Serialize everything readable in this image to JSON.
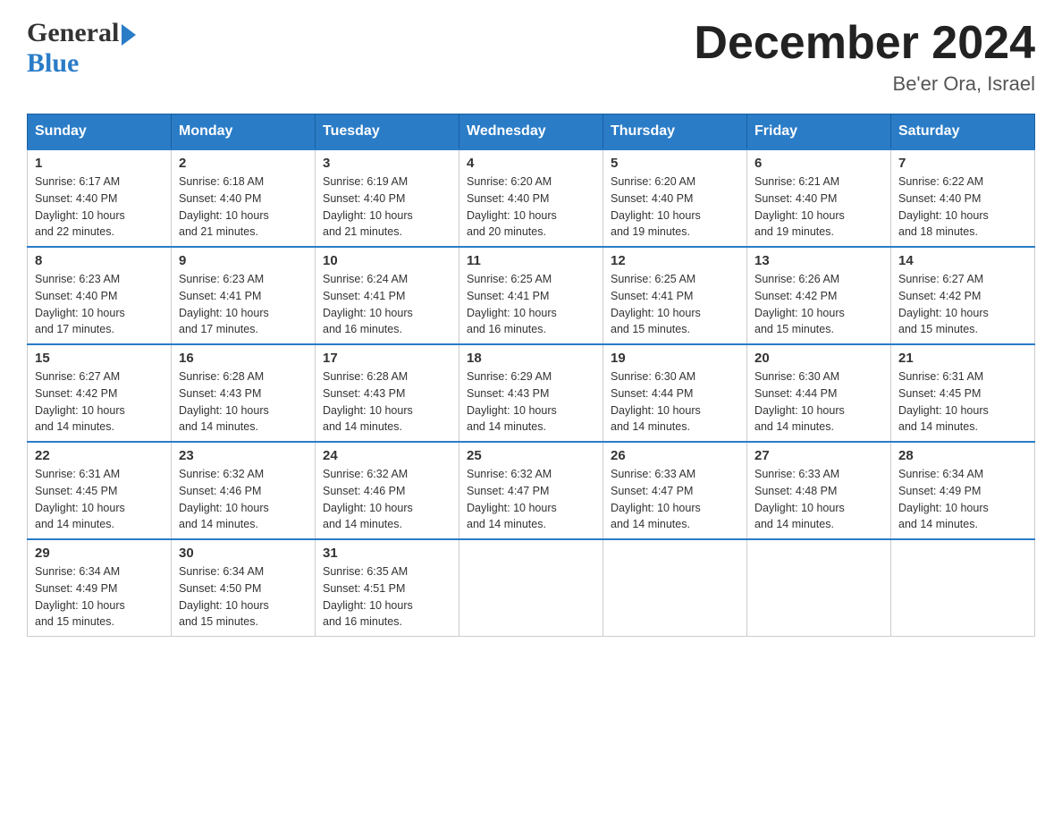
{
  "header": {
    "logo_line1": "General",
    "logo_line2": "Blue",
    "month": "December 2024",
    "location": "Be'er Ora, Israel"
  },
  "days_of_week": [
    "Sunday",
    "Monday",
    "Tuesday",
    "Wednesday",
    "Thursday",
    "Friday",
    "Saturday"
  ],
  "weeks": [
    [
      {
        "day": "1",
        "sunrise": "6:17 AM",
        "sunset": "4:40 PM",
        "daylight": "10 hours and 22 minutes."
      },
      {
        "day": "2",
        "sunrise": "6:18 AM",
        "sunset": "4:40 PM",
        "daylight": "10 hours and 21 minutes."
      },
      {
        "day": "3",
        "sunrise": "6:19 AM",
        "sunset": "4:40 PM",
        "daylight": "10 hours and 21 minutes."
      },
      {
        "day": "4",
        "sunrise": "6:20 AM",
        "sunset": "4:40 PM",
        "daylight": "10 hours and 20 minutes."
      },
      {
        "day": "5",
        "sunrise": "6:20 AM",
        "sunset": "4:40 PM",
        "daylight": "10 hours and 19 minutes."
      },
      {
        "day": "6",
        "sunrise": "6:21 AM",
        "sunset": "4:40 PM",
        "daylight": "10 hours and 19 minutes."
      },
      {
        "day": "7",
        "sunrise": "6:22 AM",
        "sunset": "4:40 PM",
        "daylight": "10 hours and 18 minutes."
      }
    ],
    [
      {
        "day": "8",
        "sunrise": "6:23 AM",
        "sunset": "4:40 PM",
        "daylight": "10 hours and 17 minutes."
      },
      {
        "day": "9",
        "sunrise": "6:23 AM",
        "sunset": "4:41 PM",
        "daylight": "10 hours and 17 minutes."
      },
      {
        "day": "10",
        "sunrise": "6:24 AM",
        "sunset": "4:41 PM",
        "daylight": "10 hours and 16 minutes."
      },
      {
        "day": "11",
        "sunrise": "6:25 AM",
        "sunset": "4:41 PM",
        "daylight": "10 hours and 16 minutes."
      },
      {
        "day": "12",
        "sunrise": "6:25 AM",
        "sunset": "4:41 PM",
        "daylight": "10 hours and 15 minutes."
      },
      {
        "day": "13",
        "sunrise": "6:26 AM",
        "sunset": "4:42 PM",
        "daylight": "10 hours and 15 minutes."
      },
      {
        "day": "14",
        "sunrise": "6:27 AM",
        "sunset": "4:42 PM",
        "daylight": "10 hours and 15 minutes."
      }
    ],
    [
      {
        "day": "15",
        "sunrise": "6:27 AM",
        "sunset": "4:42 PM",
        "daylight": "10 hours and 14 minutes."
      },
      {
        "day": "16",
        "sunrise": "6:28 AM",
        "sunset": "4:43 PM",
        "daylight": "10 hours and 14 minutes."
      },
      {
        "day": "17",
        "sunrise": "6:28 AM",
        "sunset": "4:43 PM",
        "daylight": "10 hours and 14 minutes."
      },
      {
        "day": "18",
        "sunrise": "6:29 AM",
        "sunset": "4:43 PM",
        "daylight": "10 hours and 14 minutes."
      },
      {
        "day": "19",
        "sunrise": "6:30 AM",
        "sunset": "4:44 PM",
        "daylight": "10 hours and 14 minutes."
      },
      {
        "day": "20",
        "sunrise": "6:30 AM",
        "sunset": "4:44 PM",
        "daylight": "10 hours and 14 minutes."
      },
      {
        "day": "21",
        "sunrise": "6:31 AM",
        "sunset": "4:45 PM",
        "daylight": "10 hours and 14 minutes."
      }
    ],
    [
      {
        "day": "22",
        "sunrise": "6:31 AM",
        "sunset": "4:45 PM",
        "daylight": "10 hours and 14 minutes."
      },
      {
        "day": "23",
        "sunrise": "6:32 AM",
        "sunset": "4:46 PM",
        "daylight": "10 hours and 14 minutes."
      },
      {
        "day": "24",
        "sunrise": "6:32 AM",
        "sunset": "4:46 PM",
        "daylight": "10 hours and 14 minutes."
      },
      {
        "day": "25",
        "sunrise": "6:32 AM",
        "sunset": "4:47 PM",
        "daylight": "10 hours and 14 minutes."
      },
      {
        "day": "26",
        "sunrise": "6:33 AM",
        "sunset": "4:47 PM",
        "daylight": "10 hours and 14 minutes."
      },
      {
        "day": "27",
        "sunrise": "6:33 AM",
        "sunset": "4:48 PM",
        "daylight": "10 hours and 14 minutes."
      },
      {
        "day": "28",
        "sunrise": "6:34 AM",
        "sunset": "4:49 PM",
        "daylight": "10 hours and 14 minutes."
      }
    ],
    [
      {
        "day": "29",
        "sunrise": "6:34 AM",
        "sunset": "4:49 PM",
        "daylight": "10 hours and 15 minutes."
      },
      {
        "day": "30",
        "sunrise": "6:34 AM",
        "sunset": "4:50 PM",
        "daylight": "10 hours and 15 minutes."
      },
      {
        "day": "31",
        "sunrise": "6:35 AM",
        "sunset": "4:51 PM",
        "daylight": "10 hours and 16 minutes."
      },
      null,
      null,
      null,
      null
    ]
  ],
  "labels": {
    "sunrise": "Sunrise:",
    "sunset": "Sunset:",
    "daylight": "Daylight:"
  }
}
